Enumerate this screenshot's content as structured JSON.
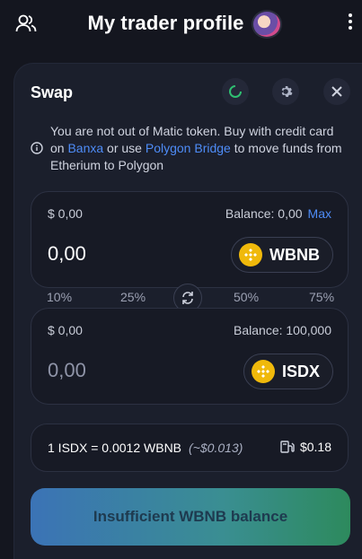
{
  "header": {
    "title": "My trader profile",
    "left_icon": "users-icon",
    "menu_icon": "kebab-icon"
  },
  "swap": {
    "title": "Swap",
    "header_buttons": [
      "refresh-icon",
      "settings-icon",
      "close-icon"
    ],
    "info": {
      "text_before": "You are not out of Matic token. Buy with credit card on ",
      "link1": "Banxa",
      "text_middle": " or use ",
      "link2": "Polygon Bridge",
      "text_after": " to move funds from Etherium to Polygon"
    },
    "from": {
      "usd": "$ 0,00",
      "balance_label": "Balance: 0,00",
      "max_label": "Max",
      "amount": "0,00",
      "token": "WBNB"
    },
    "percents": [
      "10%",
      "25%",
      "50%",
      "75%"
    ],
    "to": {
      "usd": "$ 0,00",
      "balance_label": "Balance: 100,000",
      "amount": "0,00",
      "token": "ISDX"
    },
    "rate": {
      "text": "1 ISDX = 0.0012 WBNB",
      "usd_estimate": "(~$0.013)",
      "gas_fee": "$0.18"
    },
    "cta_label": "Insufficient WBNB balance"
  },
  "colors": {
    "background": "#14161f",
    "card": "#1b1f2c",
    "link": "#4e8cf7",
    "bnb": "#f0b90b"
  }
}
